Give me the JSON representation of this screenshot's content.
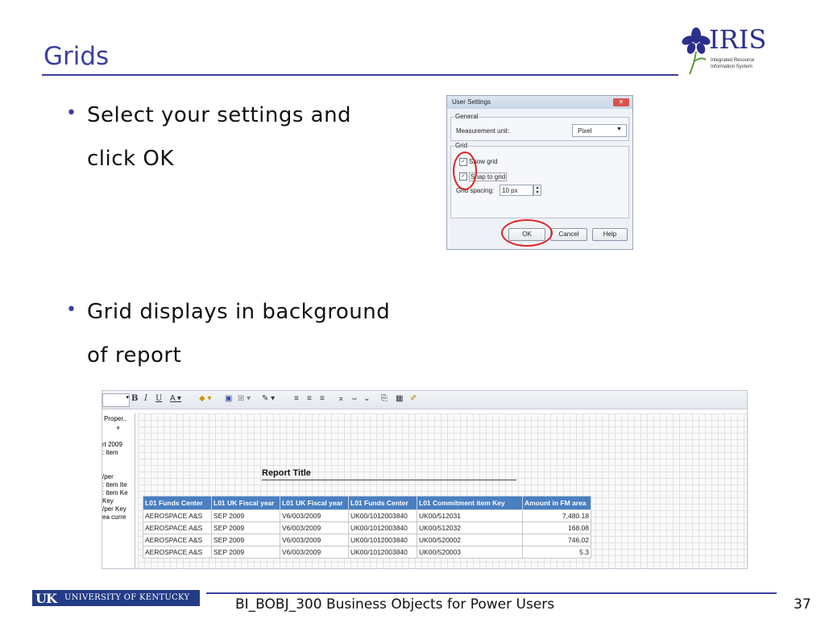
{
  "slide": {
    "title": "Grids",
    "bullets": [
      {
        "line1": "Select your settings and",
        "line2": "click OK"
      },
      {
        "line1": "Grid displays in background",
        "line2": "of report"
      }
    ],
    "logo": {
      "word": "IRIS",
      "sub1": "Integrated Resource",
      "sub2": "Information System"
    }
  },
  "dialog": {
    "title": "User Settings",
    "close_label": "✕",
    "general_group": "General",
    "measurement_label": "Measurement unit:",
    "measurement_value": "Pixel",
    "grid_group": "Grid",
    "show_grid_label": "Show grid",
    "show_grid_checked": true,
    "snap_label": "Snap to grid",
    "snap_checked": true,
    "spacing_label": "Grid spacing:",
    "spacing_value": "10 px",
    "ok_label": "OK",
    "cancel_label": "Cancel",
    "help_label": "Help"
  },
  "report_window": {
    "left_panel": {
      "tab": "Proper..",
      "pin": "ᵠ",
      "items": [
        "rt 2009",
        ": item",
        "",
        "/per",
        ": item Ite",
        ": item Ke",
        " Key",
        "/per Key",
        "ea curre"
      ]
    },
    "report_title": "Report Title",
    "columns": [
      "L01 Funds Center",
      "L01 UK Fiscal year",
      "L01 UK Fiscal year",
      "L01 Funds Center",
      "L01 Commitment item Key",
      "Amount in FM area"
    ],
    "rows": [
      [
        "AEROSPACE A&S",
        "SEP 2009",
        "V6/003/2009",
        "UK00/1012003840",
        "UK00/512031",
        "7,480.18"
      ],
      [
        "AEROSPACE A&S",
        "SEP 2009",
        "V6/003/2009",
        "UK00/1012003840",
        "UK00/512032",
        "168.08"
      ],
      [
        "AEROSPACE A&S",
        "SEP 2009",
        "V6/003/2009",
        "UK00/1012003840",
        "UK00/520002",
        "746.02"
      ],
      [
        "AEROSPACE A&S",
        "SEP 2009",
        "V6/003/2009",
        "UK00/1012003840",
        "UK00/520003",
        "5.3"
      ]
    ]
  },
  "footer": {
    "uk_letters": "UK",
    "university": "UNIVERSITY OF KENTUCKY",
    "course": "BI_BOBJ_300 Business Objects for Power Users",
    "page": "37"
  },
  "colors": {
    "title_blue": "#3b3fa0",
    "table_header": "#4a7fc0",
    "highlight_ring": "#e02222",
    "uk_blue": "#243b86"
  }
}
